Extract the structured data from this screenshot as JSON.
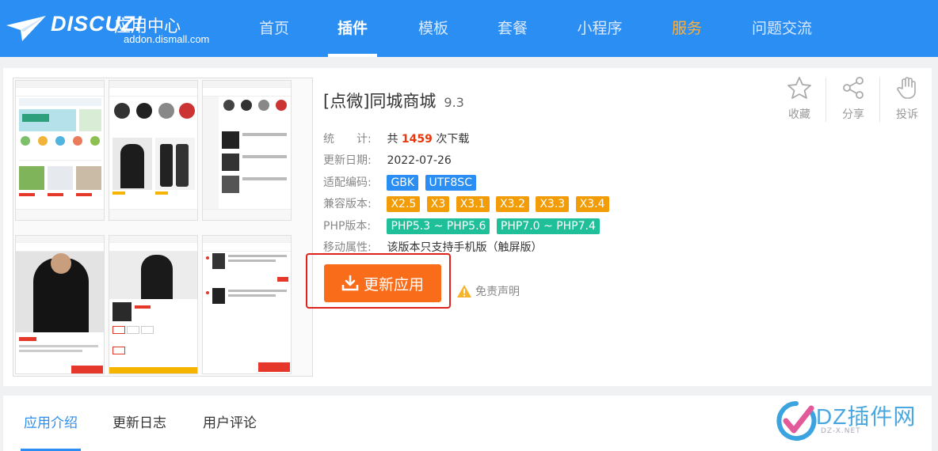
{
  "header": {
    "logo_text": "DISCUZ!",
    "logo_subtitle": "应用中心",
    "logo_url": "addon.dismall.com",
    "nav": [
      {
        "label": "首页"
      },
      {
        "label": "插件"
      },
      {
        "label": "模板"
      },
      {
        "label": "套餐"
      },
      {
        "label": "小程序"
      },
      {
        "label": "服务"
      },
      {
        "label": "问题交流"
      }
    ],
    "active_nav": "插件",
    "colors": {
      "bar": "#2b8ef2",
      "hot": "#ffb03a"
    }
  },
  "plugin": {
    "title": "[点微]同城商城",
    "version": "9.3",
    "stats_label": "统　　计:",
    "stats_prefix": "共",
    "downloads": "1459",
    "stats_suffix": "次下载",
    "updated_label": "更新日期:",
    "updated_value": "2022-07-26",
    "encoding_label": "适配编码:",
    "encodings": [
      "GBK",
      "UTF8SC"
    ],
    "compat_label": "兼容版本:",
    "compat_versions": [
      "X2.5",
      "X3",
      "X3.1",
      "X3.2",
      "X3.3",
      "X3.4"
    ],
    "php_label": "PHP版本:",
    "php_versions": [
      "PHP5.3 ~ PHP5.6",
      "PHP7.0 ~ PHP7.4"
    ],
    "mobile_label": "移动属性:",
    "mobile_value": "该版本只支持手机版（触屏版）",
    "update_button": "更新应用",
    "disclaimer": "免责声明"
  },
  "actions": [
    {
      "label": "收藏",
      "icon": "star-icon"
    },
    {
      "label": "分享",
      "icon": "share-icon"
    },
    {
      "label": "投诉",
      "icon": "hand-icon"
    }
  ],
  "tabs": [
    {
      "label": "应用介绍"
    },
    {
      "label": "更新日志"
    },
    {
      "label": "用户评论"
    }
  ],
  "watermark": {
    "text": "DZ插件网",
    "sub": "DZ-X.NET"
  }
}
